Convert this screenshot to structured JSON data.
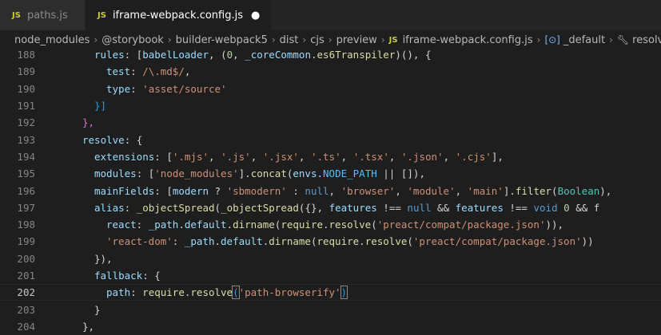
{
  "tabs": [
    {
      "icon": "JS",
      "label": "paths.js",
      "active": false,
      "dirty": false
    },
    {
      "icon": "JS",
      "label": "iframe-webpack.config.js",
      "active": true,
      "dirty": true
    }
  ],
  "breadcrumb": {
    "items": [
      "node_modules",
      "@storybook",
      "builder-webpack5",
      "dist",
      "cjs",
      "preview"
    ],
    "file_icon": "JS",
    "file": "iframe-webpack.config.js",
    "symbol_icon": "[⊙]",
    "symbol": "_default",
    "wrench_icon": "🔧",
    "method": "resolve"
  },
  "editor": {
    "current_line": 202,
    "lines": [
      {
        "n": 188
      },
      {
        "n": 189
      },
      {
        "n": 190
      },
      {
        "n": 191
      },
      {
        "n": 192
      },
      {
        "n": 193
      },
      {
        "n": 194
      },
      {
        "n": 195
      },
      {
        "n": 196
      },
      {
        "n": 197
      },
      {
        "n": 198
      },
      {
        "n": 199
      },
      {
        "n": 200
      },
      {
        "n": 201
      },
      {
        "n": 202
      },
      {
        "n": 203
      },
      {
        "n": 204
      }
    ],
    "tokens": {
      "l188": [
        "rules",
        ": [",
        "babelLoader",
        ", (",
        "0",
        ", ",
        "_coreCommon",
        ".",
        "es6Transpiler",
        ")(), {"
      ],
      "l189": [
        "test",
        ": ",
        "/\\.md$/",
        ","
      ],
      "l190": [
        "type",
        ": ",
        "'asset/source'"
      ],
      "l191": [
        "}]"
      ],
      "l192": [
        "},"
      ],
      "l193": [
        "resolve",
        ": {"
      ],
      "l194": [
        "extensions",
        ": [",
        "'.mjs'",
        ", ",
        "'.js'",
        ", ",
        "'.jsx'",
        ", ",
        "'.ts'",
        ", ",
        "'.tsx'",
        ", ",
        "'.json'",
        ", ",
        "'.cjs'",
        "],"
      ],
      "l195": [
        "modules",
        ": [",
        "'node_modules'",
        "].",
        "concat",
        "(",
        "envs",
        ".",
        "NODE_PATH",
        " || [",
        "]),"
      ],
      "l196": [
        "mainFields",
        ": [",
        "modern",
        " ? ",
        "'sbmodern'",
        " : ",
        "null",
        ", ",
        "'browser'",
        ", ",
        "'module'",
        ", ",
        "'main'",
        "].",
        "filter",
        "(",
        "Boolean",
        "),"
      ],
      "l197": [
        "alias",
        ": ",
        "_objectSpread",
        "(",
        "_objectSpread",
        "({}, ",
        "features",
        " !== ",
        "null",
        " && ",
        "features",
        " !== ",
        "void",
        " ",
        "0",
        " && f"
      ],
      "l198": [
        "react",
        ": ",
        "_path",
        ".",
        "default",
        ".",
        "dirname",
        "(",
        "require",
        ".",
        "resolve",
        "(",
        "'preact/compat/package.json'",
        ")),"
      ],
      "l199": [
        "'react-dom'",
        ": ",
        "_path",
        ".",
        "default",
        ".",
        "dirname",
        "(",
        "require",
        ".",
        "resolve",
        "(",
        "'preact/compat/package.json'",
        "))"
      ],
      "l200": [
        "}),"
      ],
      "l201": [
        "fallback",
        ": {"
      ],
      "l202": [
        "path",
        ": ",
        "require",
        ".",
        "resolve",
        "(",
        "'path-browserify'",
        ")"
      ],
      "l203": [
        "}"
      ],
      "l204": [
        "},"
      ]
    }
  },
  "colors": {
    "background": "#1e1e1e",
    "tab_bar": "#252526",
    "property": "#9cdcfe",
    "string": "#ce9178",
    "function": "#dcdcaa",
    "keyword": "#569cd6",
    "js_badge": "#cbcb41"
  }
}
